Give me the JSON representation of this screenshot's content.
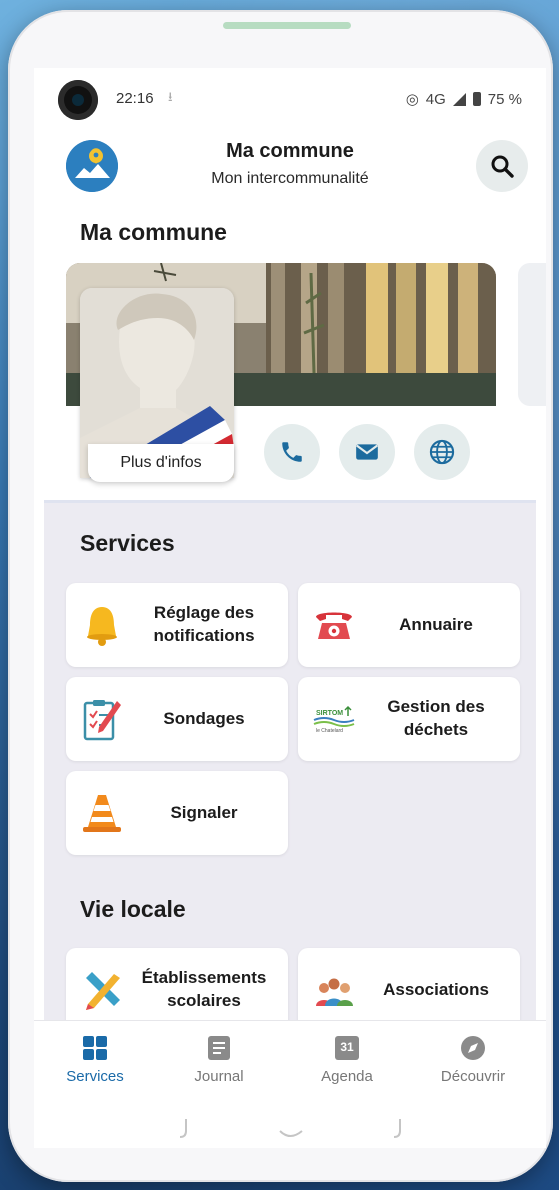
{
  "status_bar": {
    "time": "22:16",
    "network": "4G",
    "battery": "75 %"
  },
  "header": {
    "title": "Ma commune",
    "subtitle": "Mon intercommunalité"
  },
  "commune_section": {
    "heading": "Ma commune",
    "more_info_label": "Plus d'infos"
  },
  "services": {
    "heading": "Services",
    "items": [
      {
        "label": "Réglage des notifications",
        "icon": "bell-icon"
      },
      {
        "label": "Annuaire",
        "icon": "phone-icon"
      },
      {
        "label": "Sondages",
        "icon": "clipboard-icon"
      },
      {
        "label": "Gestion des déchets",
        "icon": "waste-logo-icon"
      },
      {
        "label": "Signaler",
        "icon": "traffic-cone-icon"
      }
    ]
  },
  "vie_locale": {
    "heading": "Vie locale",
    "items": [
      {
        "label": "Établissements scolaires",
        "icon": "ruler-pencil-icon"
      },
      {
        "label": "Associations",
        "icon": "people-icon"
      }
    ]
  },
  "bottom_nav": {
    "items": [
      {
        "label": "Services",
        "icon": "grid-icon",
        "active": true
      },
      {
        "label": "Journal",
        "icon": "journal-icon",
        "active": false
      },
      {
        "label": "Agenda",
        "icon": "calendar-icon",
        "date": "31",
        "active": false
      },
      {
        "label": "Découvrir",
        "icon": "compass-icon",
        "active": false
      }
    ]
  },
  "colors": {
    "accent": "#1a6aa8",
    "panel_bg": "#ecebf2",
    "icon_button_bg": "#e4ecec",
    "icon_blue": "#1c6b9e"
  }
}
